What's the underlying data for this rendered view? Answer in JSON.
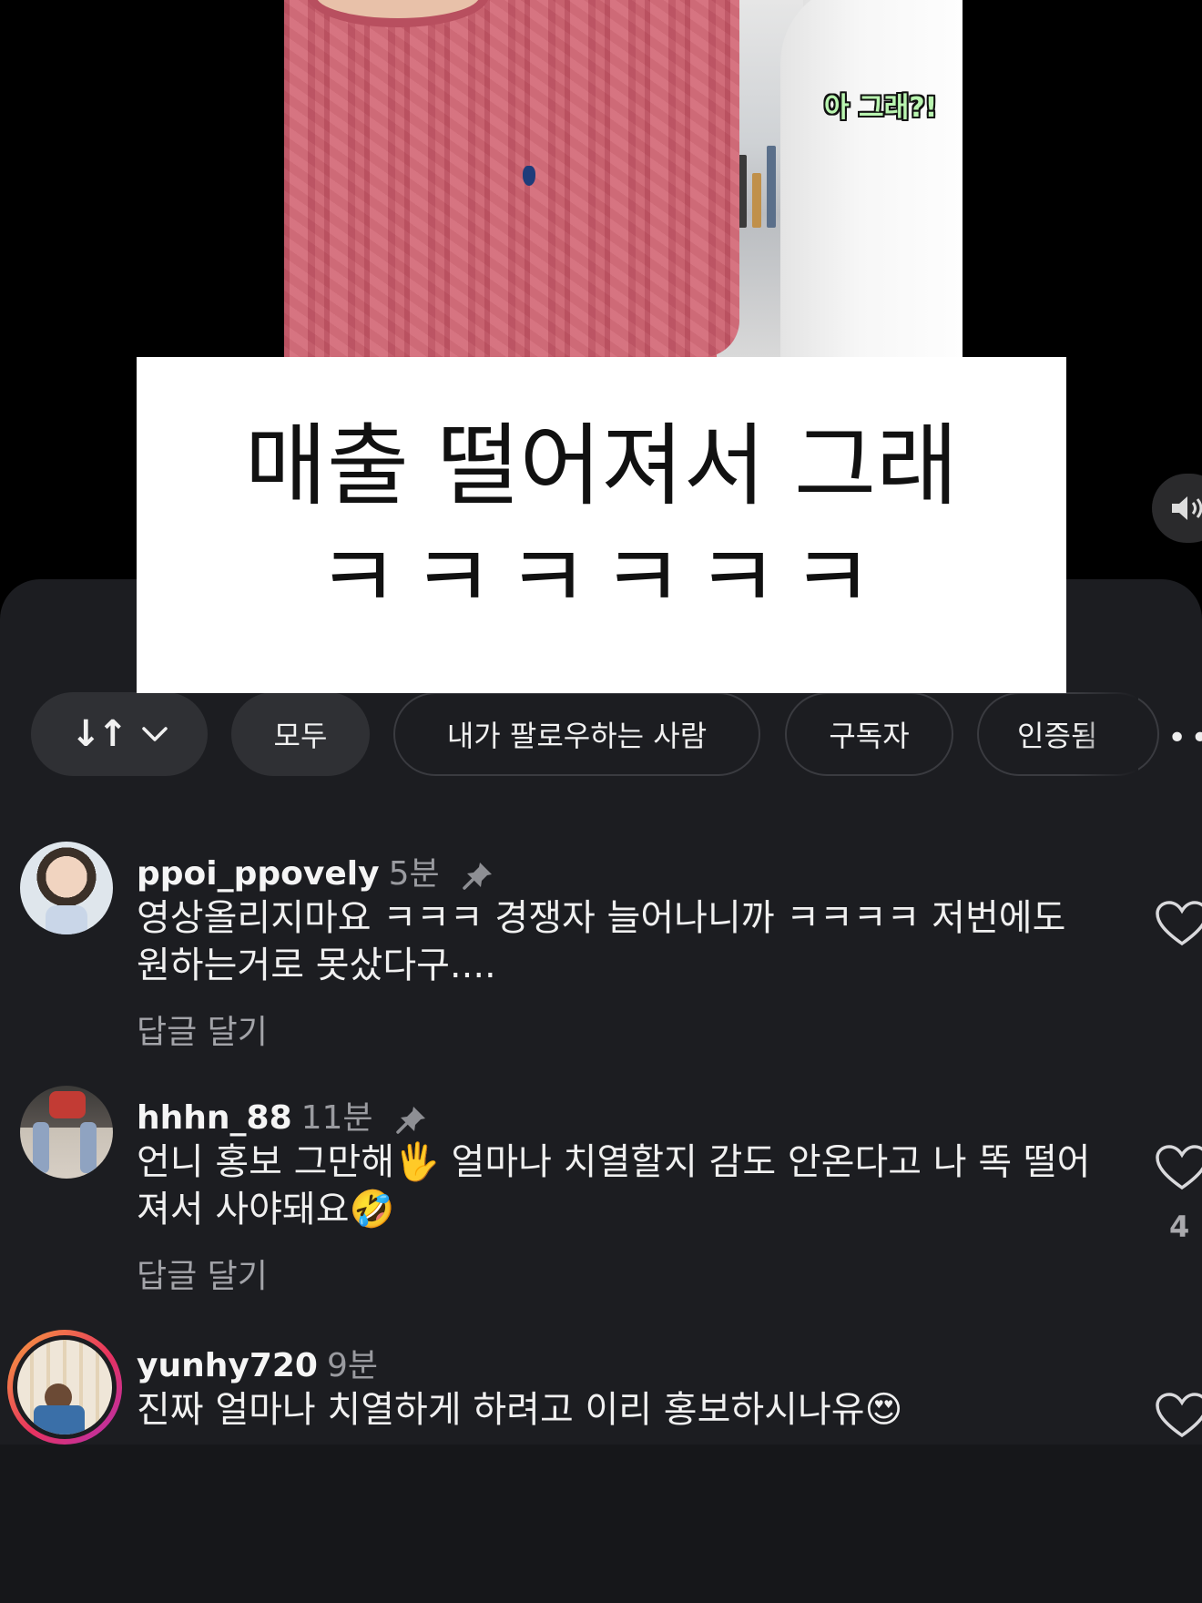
{
  "video": {
    "caption": "아 그래?!",
    "overlay_line1": "매출 떨어져서 그래",
    "overlay_line2": "ㅋㅋㅋㅋㅋㅋ"
  },
  "icons": {
    "sound": "speaker-icon",
    "sort": "sort-arrows-icon",
    "chevron": "chevron-down-icon",
    "more": "more-dots-icon",
    "pin": "pin-icon",
    "like": "heart-icon"
  },
  "filters": {
    "sort_glyph": "↓↑",
    "chips": [
      "모두",
      "내가 팔로우하는 사람",
      "구독자",
      "인증됨"
    ],
    "more": "••"
  },
  "comments": [
    {
      "username": "ppoi_ppovely",
      "time": "5분",
      "pinned": true,
      "text": "영상올리지마요 ㅋㅋㅋ 경쟁자 늘어나니까 ㅋㅋㅋㅋ  저번에도 원하는거로 못샀다구....",
      "reply_label": "답글 달기",
      "like_count": ""
    },
    {
      "username": "hhhn_88",
      "time": "11분",
      "pinned": true,
      "text": "언니 홍보 그만해🖐 얼마나 치열할지 감도 안온다고 나 똑 떨어져서 사야돼요🤣",
      "reply_label": "답글 달기",
      "like_count": "4"
    },
    {
      "username": "yunhy720",
      "time": "9분",
      "pinned": false,
      "text": "진짜 얼마나 치열하게 하려고 이리 홍보하시나유😍",
      "reply_label": "",
      "like_count": ""
    }
  ],
  "colors": {
    "sheet_bg": "#1c1d21",
    "chip_filled": "#2f3034",
    "story_ring": "#e8335f"
  }
}
